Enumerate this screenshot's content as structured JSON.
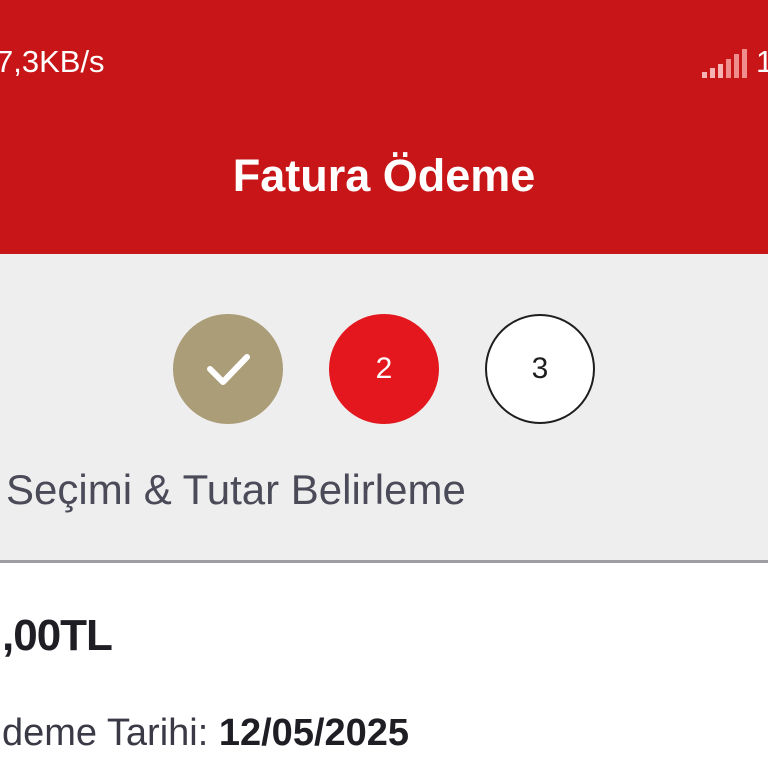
{
  "status_bar": {
    "network_speed": "7,3KB/s",
    "edge_text": "1",
    "signal_icon": "signal-bars-icon"
  },
  "header": {
    "title": "Fatura Ödeme",
    "background": "#c81618"
  },
  "stepper": {
    "steps": [
      {
        "state": "completed",
        "icon": "check-icon",
        "color": "#ab9d78"
      },
      {
        "state": "active",
        "number": "2",
        "color": "#e3171d"
      },
      {
        "state": "pending",
        "number": "3"
      }
    ],
    "current_label": "Seçimi & Tutar Belirleme"
  },
  "content": {
    "amount": ",00TL",
    "due_date_label": "deme Tarihi:",
    "due_date_value": "12/05/2025"
  }
}
